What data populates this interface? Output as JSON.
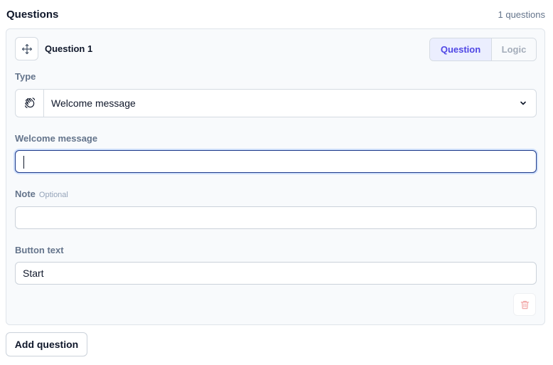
{
  "header": {
    "title": "Questions",
    "count": "1 questions"
  },
  "question": {
    "title": "Question 1",
    "tabs": [
      {
        "label": "Question",
        "active": true
      },
      {
        "label": "Logic",
        "active": false
      }
    ],
    "type": {
      "label": "Type",
      "value": "Welcome message",
      "icon": "waving-hand-icon"
    },
    "welcome_message": {
      "label": "Welcome message",
      "value": ""
    },
    "note": {
      "label": "Note",
      "optional": "Optional",
      "value": ""
    },
    "button_text": {
      "label": "Button text",
      "value": "Start"
    }
  },
  "add_question_label": "Add question",
  "colors": {
    "accent": "#4f46e5",
    "accent_bg": "#ebeefe",
    "muted_text": "#64748b",
    "border": "#d5dbe2",
    "danger_icon": "#f2a8a8"
  }
}
